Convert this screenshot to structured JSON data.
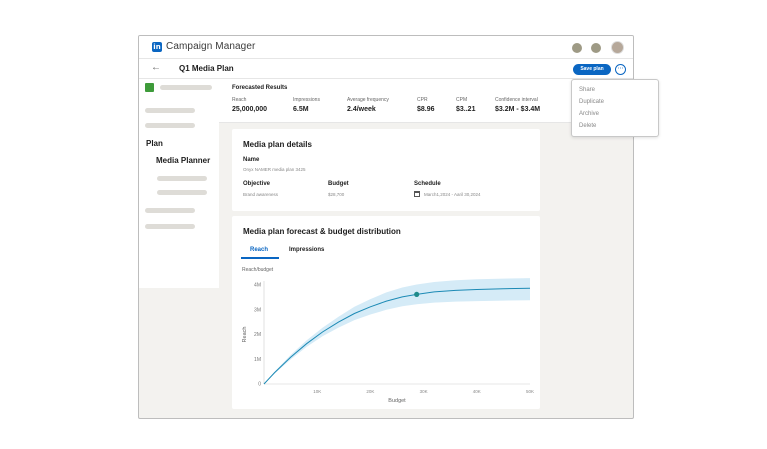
{
  "app": {
    "logo_text": "in",
    "title": "Campaign Manager"
  },
  "header": {
    "back_icon": "arrow-left-icon",
    "plan_title": "Q1 Media Plan",
    "save_label": "Save plan",
    "more_icon": "ellipsis-icon"
  },
  "sidebar": {
    "plan_label": "Plan",
    "planner_label": "Media Planner"
  },
  "forecast": {
    "title": "Forecasted Results",
    "metrics": [
      {
        "label": "Reach",
        "value": "25,000,000"
      },
      {
        "label": "Impressions",
        "value": "6.5M"
      },
      {
        "label": "Average frequency",
        "value": "2.4/week"
      },
      {
        "label": "CPR",
        "value": "$8.96"
      },
      {
        "label": "CPM",
        "value": "$3..21"
      },
      {
        "label": "Confidence interval",
        "value": "$3.2M - $3.4M"
      }
    ]
  },
  "details": {
    "title": "Media plan details",
    "name_label": "Name",
    "name_value": "Onyx NAMER media plan 3425",
    "objective_label": "Objective",
    "objective_value": "Brand awareness",
    "budget_label": "Budget",
    "budget_value": "$28,700",
    "schedule_label": "Schedule",
    "schedule_value": "March1,2024 - Aaril 30,2024"
  },
  "forecast_chart": {
    "title": "Media plan forecast & budget distribution",
    "tabs": [
      "Reach",
      "Impressions"
    ],
    "active_tab": "Reach",
    "subtitle": "Reach/budget"
  },
  "menu": {
    "items": [
      "Share",
      "Duplicate",
      "Archive",
      "Delete"
    ]
  },
  "colors": {
    "accent": "#0a66c2",
    "line": "#1c8ab5",
    "band": "#d5ebf7",
    "marker": "#1e8a8a"
  },
  "chart_data": {
    "type": "line",
    "xlabel": "Budget",
    "ylabel": "Reach",
    "x_ticks": [
      "10K",
      "20K",
      "30K",
      "40K",
      "50K"
    ],
    "y_ticks": [
      "0",
      "1M",
      "2M",
      "3M",
      "4M"
    ],
    "xlim": [
      0,
      50000
    ],
    "ylim": [
      0,
      4000000
    ],
    "series": [
      {
        "x": [
          0,
          2000,
          5000,
          8000,
          11000,
          14000,
          17000,
          20000,
          23000,
          26000,
          28700,
          32000,
          36000,
          40000,
          45000,
          50000
        ],
        "y": [
          0,
          460000,
          1080000,
          1630000,
          2100000,
          2500000,
          2850000,
          3120000,
          3350000,
          3520000,
          3620000,
          3720000,
          3780000,
          3820000,
          3850000,
          3870000
        ],
        "lower": [
          0,
          420000,
          990000,
          1500000,
          1930000,
          2280000,
          2580000,
          2810000,
          3000000,
          3140000,
          3220000,
          3290000,
          3330000,
          3350000,
          3370000,
          3380000
        ],
        "upper": [
          0,
          500000,
          1170000,
          1760000,
          2270000,
          2720000,
          3120000,
          3430000,
          3700000,
          3900000,
          4020000,
          4120000,
          4190000,
          4230000,
          4260000,
          4280000
        ]
      }
    ],
    "highlight_point": {
      "x": 28700,
      "y": 3620000
    },
    "grid": false
  }
}
